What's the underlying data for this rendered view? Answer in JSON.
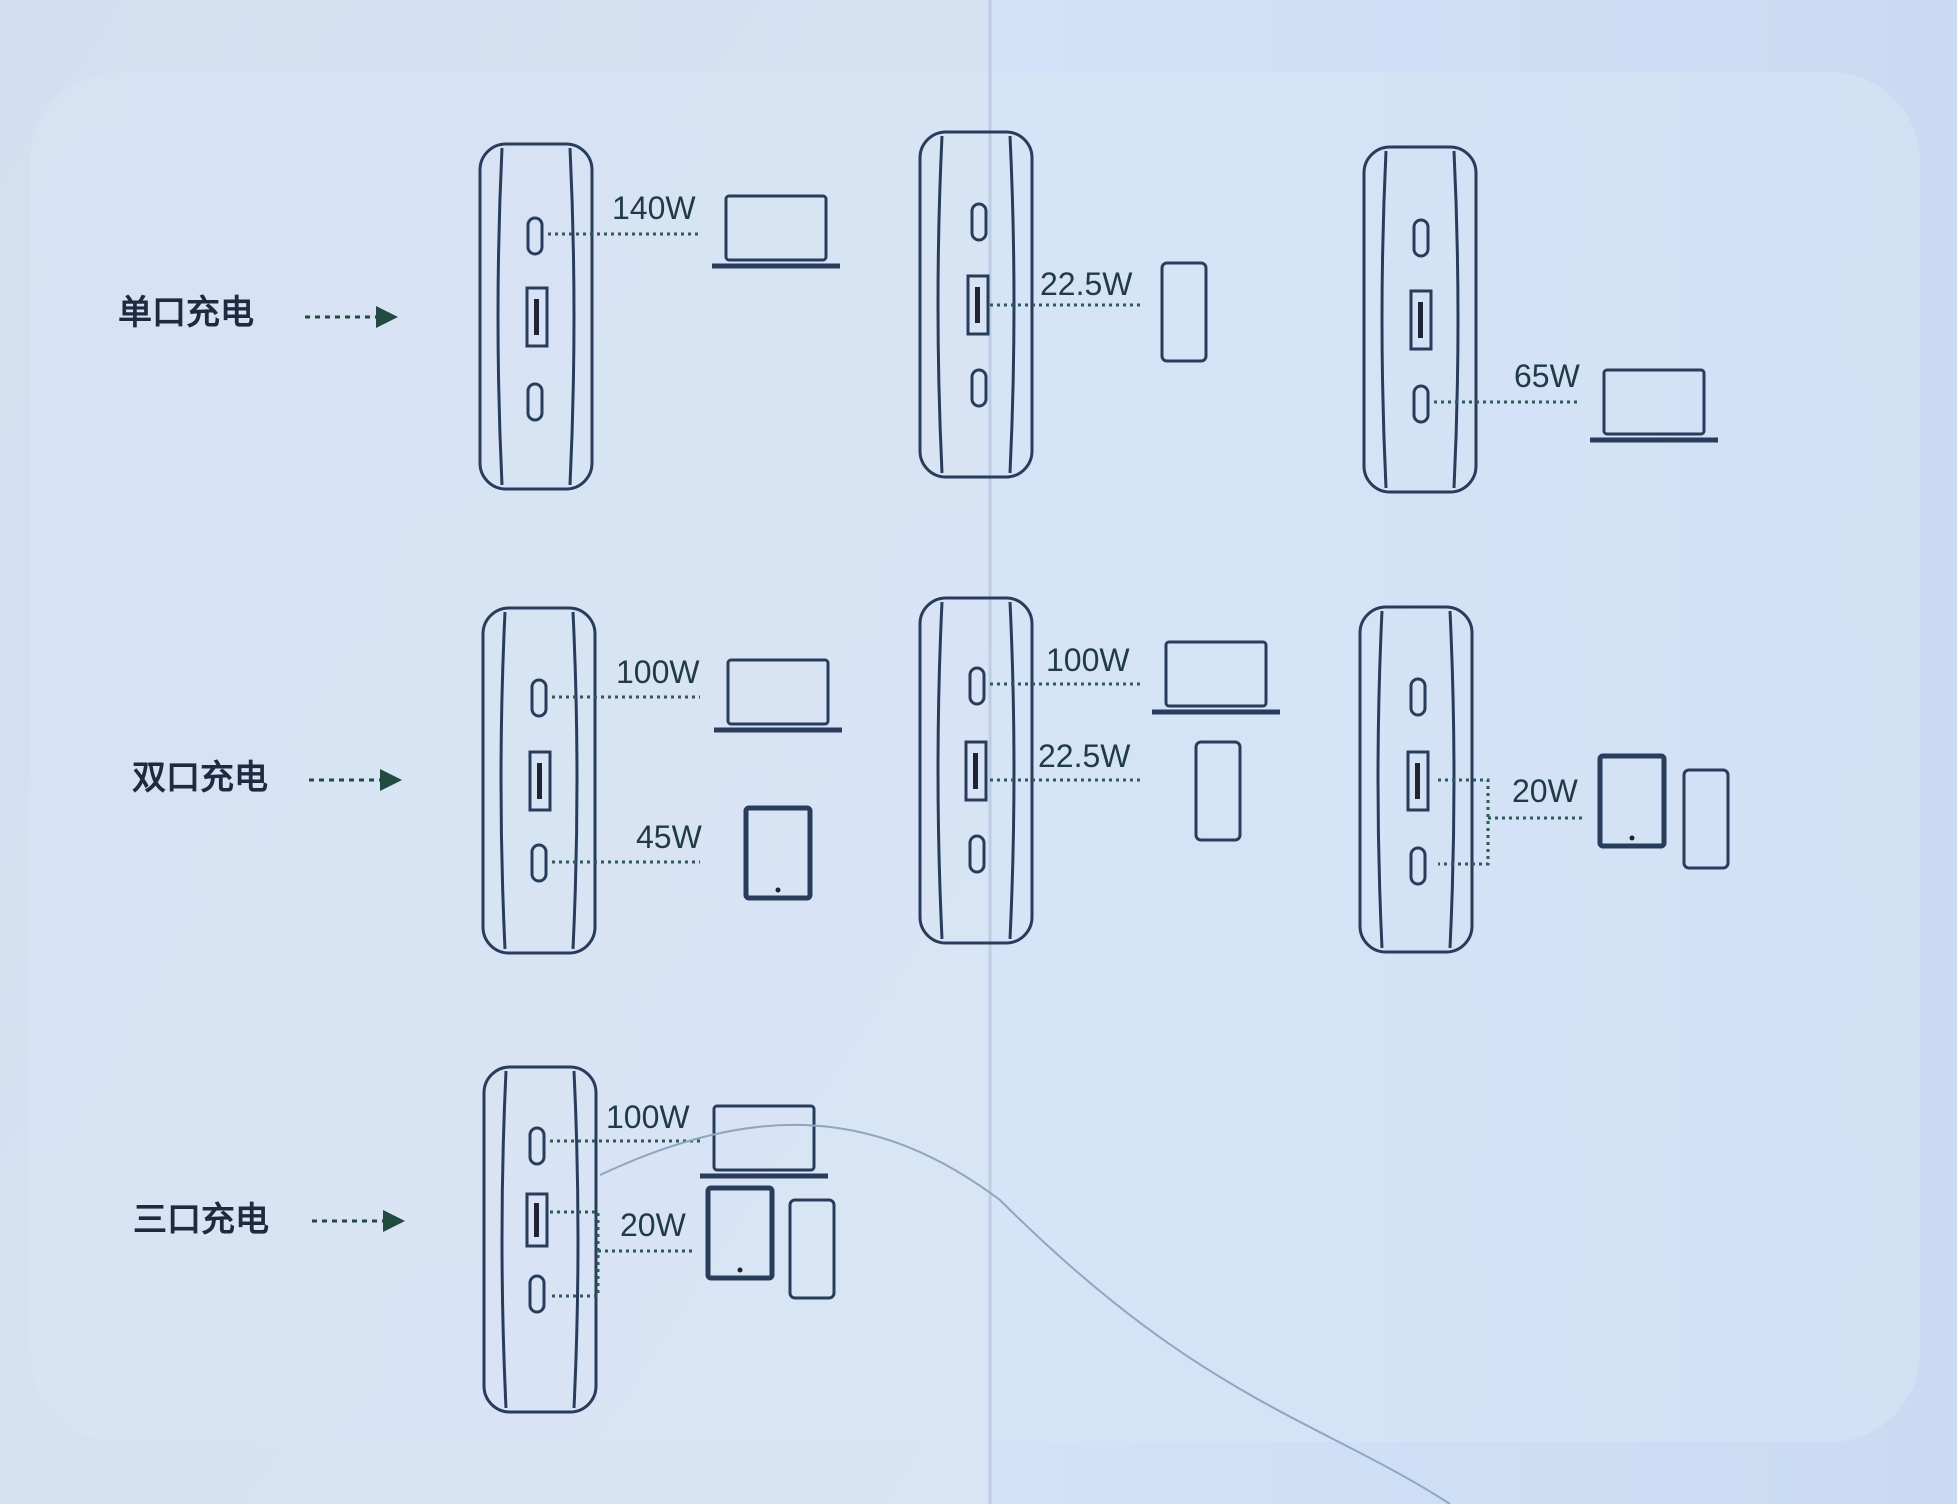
{
  "rows": [
    {
      "label": "单口充电"
    },
    {
      "label": "双口充电"
    },
    {
      "label": "三口充电"
    }
  ],
  "watts": {
    "r1c1": "140W",
    "r1c2": "22.5W",
    "r1c3": "65W",
    "r2c1_top": "100W",
    "r2c1_bottom": "45W",
    "r2c2_top": "100W",
    "r2c2_mid": "22.5W",
    "r2c3": "20W",
    "r3c1_top": "100W",
    "r3c1_bottom": "20W"
  },
  "colors": {
    "paper_left": "#d6e3f4",
    "paper_right": "#cfe0f6",
    "line": "#283d5c",
    "accent_green": "#214a40"
  }
}
